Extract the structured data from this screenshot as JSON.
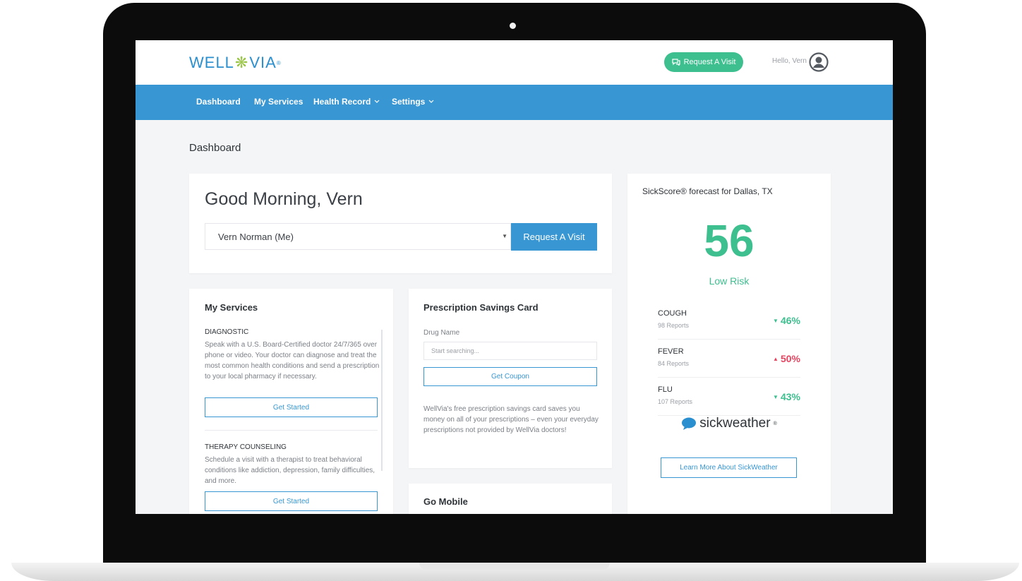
{
  "header": {
    "logo_left": "WELL",
    "logo_right": "VIA",
    "logo_mark": "®",
    "request_visit_label": "Request A Visit",
    "greeting": "Hello, Vern"
  },
  "nav": {
    "items": [
      {
        "label": "Dashboard"
      },
      {
        "label": "My Services"
      },
      {
        "label": "Health Record"
      },
      {
        "label": "Settings"
      }
    ]
  },
  "page": {
    "title": "Dashboard"
  },
  "welcome": {
    "greeting": "Good Morning, Vern",
    "member_select_value": "Vern Norman (Me)",
    "request_visit_label": "Request A Visit"
  },
  "services": {
    "title": "My Services",
    "items": [
      {
        "heading": "DIAGNOSTIC",
        "description": "Speak with a U.S. Board-Certified doctor 24/7/365 over phone or video. Your doctor can diagnose and treat the most common health conditions and send a prescription to your local pharmacy if necessary.",
        "button": "Get Started"
      },
      {
        "heading": "THERAPY COUNSELING",
        "description": "Schedule a visit with a therapist to treat behavioral conditions like addiction, depression, family difficulties, and more.",
        "button": "Get Started"
      }
    ]
  },
  "rx": {
    "title": "Prescription Savings Card",
    "drug_label": "Drug Name",
    "drug_placeholder": "Start searching...",
    "coupon_button": "Get Coupon",
    "description": "WellVia's free prescription savings card saves you money on all of your prescriptions – even your everyday prescriptions not provided by WellVia doctors!"
  },
  "mobile": {
    "title": "Go Mobile"
  },
  "sickscore": {
    "title": "SickScore® forecast for Dallas, TX",
    "score": "56",
    "risk": "Low Risk",
    "symptoms": [
      {
        "name": "COUGH",
        "reports": "98 Reports",
        "change": "46%",
        "direction": "down",
        "color": "#3dbf8f"
      },
      {
        "name": "FEVER",
        "reports": "84 Reports",
        "change": "50%",
        "direction": "up",
        "color": "#e8435f"
      },
      {
        "name": "FLU",
        "reports": "107 Reports",
        "change": "43%",
        "direction": "down",
        "color": "#3dbf8f"
      }
    ],
    "brand": "sickweather",
    "brand_mark": "®",
    "learn_more": "Learn More About SickWeather"
  },
  "colors": {
    "accent_blue": "#3896d3",
    "accent_green": "#3dbf8f",
    "alert_red": "#e8435f"
  },
  "icons": {
    "visit_button": "chat-bubbles-icon",
    "user": "user-avatar-icon",
    "dropdown": "chevron-down-icon",
    "trend_down": "triangle-down-icon",
    "trend_up": "triangle-up-icon",
    "brand": "speech-bubble-icon"
  }
}
